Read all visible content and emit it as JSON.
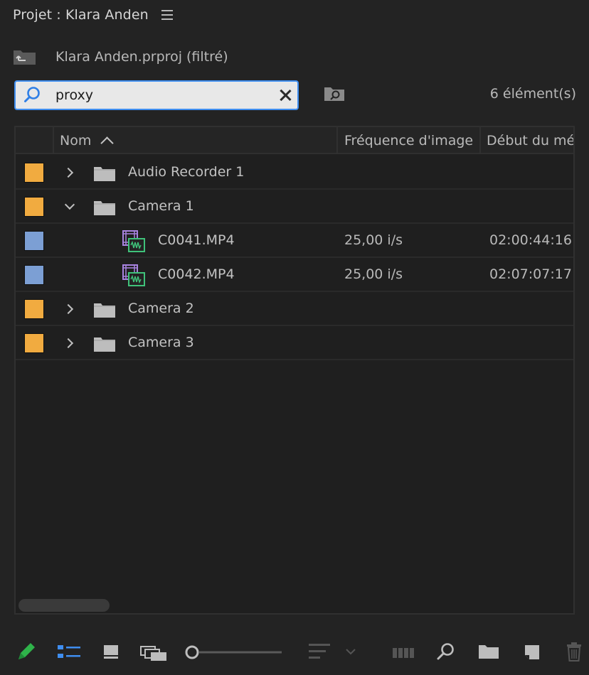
{
  "panel": {
    "title": "Projet : Klara Anden",
    "path_label": "Klara Anden.prproj (filtré)",
    "item_count": "6 élément(s)"
  },
  "search": {
    "value": "proxy",
    "placeholder": ""
  },
  "columns": {
    "name": "Nom",
    "frame_rate": "Fréquence d'image",
    "media_start": "Début du mé"
  },
  "rows": [
    {
      "name": "Audio Recorder 1",
      "type": "folder",
      "expanded": false,
      "label_color": "#f1ab40",
      "fps": "",
      "start": ""
    },
    {
      "name": "Camera 1",
      "type": "folder",
      "expanded": true,
      "label_color": "#f1ab40",
      "fps": "",
      "start": ""
    },
    {
      "name": "C0041.MP4",
      "type": "clip",
      "label_color": "#7c9fd4",
      "fps": "25,00 i/s",
      "start": "02:00:44:16"
    },
    {
      "name": "C0042.MP4",
      "type": "clip",
      "label_color": "#7c9fd4",
      "fps": "25,00 i/s",
      "start": "02:07:07:17"
    },
    {
      "name": "Camera 2",
      "type": "folder",
      "expanded": false,
      "label_color": "#f1ab40",
      "fps": "",
      "start": ""
    },
    {
      "name": "Camera 3",
      "type": "folder",
      "expanded": false,
      "label_color": "#f1ab40",
      "fps": "",
      "start": ""
    }
  ],
  "icons": {
    "panel_menu": "hamburger-menu-icon",
    "path": "folder-up-icon",
    "search": "magnifier-icon",
    "clear": "close-icon",
    "bin_search": "find-in-bin-icon",
    "folder": "folder-icon",
    "clip": "video-clip-icon"
  },
  "colors": {
    "accent": "#3f8ef0",
    "folder_label": "#f1ab40",
    "clip_label": "#7c9fd4",
    "write_icon": "#2fb34a"
  },
  "toolbar": {
    "items": [
      "pencil-icon",
      "list-view-icon",
      "icon-view-icon",
      "freeform-view-icon",
      "zoom-slider",
      "sort-icons-icon",
      "automate-to-sequence-icon",
      "find-icon",
      "new-bin-icon",
      "new-item-icon",
      "trash-icon"
    ]
  }
}
